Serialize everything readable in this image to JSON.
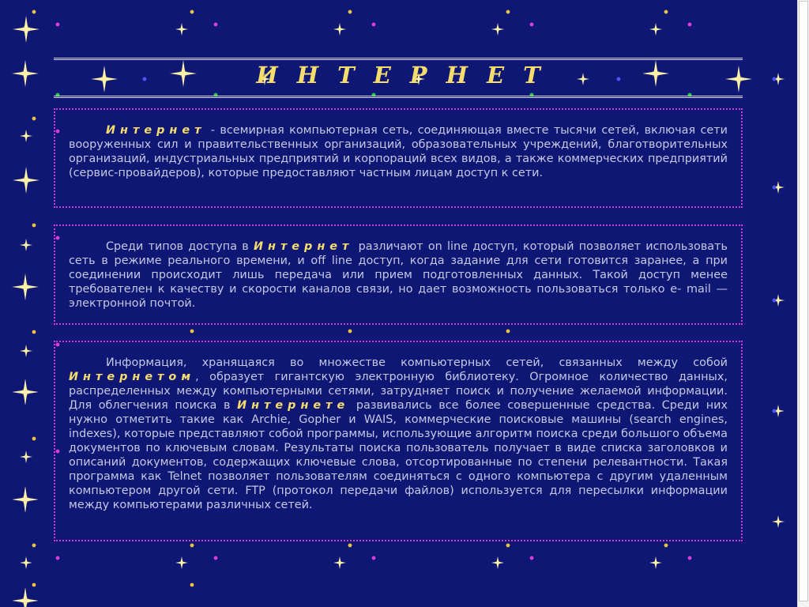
{
  "page": {
    "title": "ИНТЕРНЕТ"
  },
  "colors": {
    "background": "#0f1775",
    "title": "#f5dc6c",
    "border": "#d03ad8",
    "text": "#c3c8e4"
  },
  "panels": [
    {
      "segments": [
        {
          "text": "Интернет",
          "term": true
        },
        {
          "text": " - всемирная компьютерная сеть, соединяющая вместе тысячи сетей, включая сети вооруженных сил и правительственных организаций, образовательных учреждений, благотворительных организаций, индустриальных предприятий и корпораций всех видов, а также коммерческих предприятий (сервис-провайдеров), которые предоставляют частным лицам доступ к сети.",
          "term": false
        }
      ]
    },
    {
      "segments": [
        {
          "text": "Среди типов доступа в ",
          "term": false
        },
        {
          "text": "Интернет",
          "term": true
        },
        {
          "text": " различают on line доступ, который позволяет использовать сеть в режиме реального времени, и off line доступ, когда задание для сети готовится заранее, а при соединении происходит лишь передача или прием подготовленных данных. Такой доступ менее требователен к качеству и скорости каналов связи, но дает возможность пользоваться только е- mail — электронной почтой.",
          "term": false
        }
      ]
    },
    {
      "segments": [
        {
          "text": "Информация, хранящаяся во множестве компьютерных сетей, связанных между собой ",
          "term": false
        },
        {
          "text": "Интернетом",
          "term": true
        },
        {
          "text": ", образует гигантскую электронную библиотеку. Огромное количество данных, распределенных между компьютерными сетями, затрудняет поиск и получение желаемой информации. Для облегчения поиска в ",
          "term": false
        },
        {
          "text": "Интернете",
          "term": true
        },
        {
          "text": " развивались все более совершенные средства. Среди них нужно отметить такие как Archie, Gopher и WAIS, коммерческие поисковые машины (search engines, indexes), которые представляют собой программы, использующие алгоритм поиска среди большого объема документов по ключевым словам. Результаты поиска пользователь получает в виде списка заголовков и описаний документов, содержащих ключевые слова, отсортированные по степени релевантности. Такая программа как Telnet позволяет пользователям соединяться с одного компьютера с другим удаленным компьютером другой сети. FTP (протокол передачи файлов) используется для пересылки информации между компьютерами различных сетей.",
          "term": false
        }
      ]
    }
  ]
}
